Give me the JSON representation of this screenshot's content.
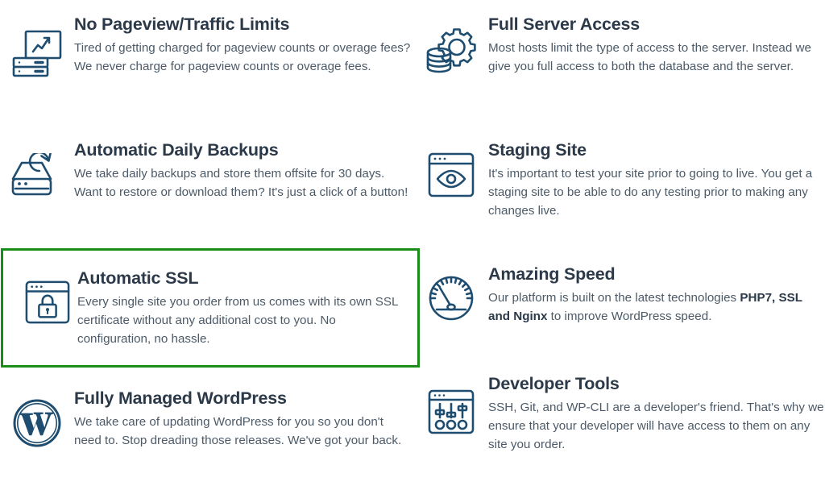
{
  "theme": {
    "background": "#ffffff",
    "title_color": "#2b3949",
    "body_color": "#4c5a68",
    "icon_color": "#1f4d70",
    "highlight_border_color": "#1a8c18"
  },
  "features": [
    {
      "id": "no-pageview-limits",
      "icon": "chart-server-icon",
      "title": "No Pageview/Traffic Limits",
      "description": "Tired of getting charged for pageview counts or overage fees? We never charge for pageview counts or overage fees.",
      "highlighted": false
    },
    {
      "id": "full-server-access",
      "icon": "database-gear-icon",
      "title": "Full Server Access",
      "description": "Most hosts limit the type of access to the server. Instead we give you full access to both the database and the server.",
      "highlighted": false
    },
    {
      "id": "automatic-daily-backups",
      "icon": "hard-drive-refresh-icon",
      "title": "Automatic Daily Backups",
      "description": "We take daily backups and store them offsite for 30 days. Want to restore or download them? It's just a click of a button!",
      "highlighted": false
    },
    {
      "id": "staging-site",
      "icon": "browser-eye-icon",
      "title": "Staging Site",
      "description": "It's important to test your site prior to going to live. You get a staging site to be able to do any testing prior to making any changes live.",
      "highlighted": false
    },
    {
      "id": "automatic-ssl",
      "icon": "browser-lock-icon",
      "title": "Automatic SSL",
      "description": "Every single site you order from us comes with its own SSL certificate without any additional cost to you. No configuration, no hassle.",
      "highlighted": true
    },
    {
      "id": "amazing-speed",
      "icon": "speedometer-icon",
      "title": "Amazing Speed",
      "description_parts": [
        {
          "text": "Our platform is built on the latest technologies ",
          "bold": false
        },
        {
          "text": "PHP7, SSL and Nginx",
          "bold": true
        },
        {
          "text": " to improve WordPress speed.",
          "bold": false
        }
      ],
      "description": "Our platform is built on the latest technologies PHP7, SSL and Nginx to improve WordPress speed.",
      "highlighted": false
    },
    {
      "id": "fully-managed-wordpress",
      "icon": "wordpress-logo-icon",
      "title": "Fully Managed WordPress",
      "description": "We take care of updating WordPress for you so you don't need to. Stop dreading those releases. We've got your back.",
      "highlighted": false
    },
    {
      "id": "developer-tools",
      "icon": "browser-sliders-icon",
      "title": "Developer Tools",
      "description": "SSH, Git, and WP-CLI are a developer's friend. That's why we ensure that your developer will have access to them on any site you order.",
      "highlighted": false
    }
  ]
}
